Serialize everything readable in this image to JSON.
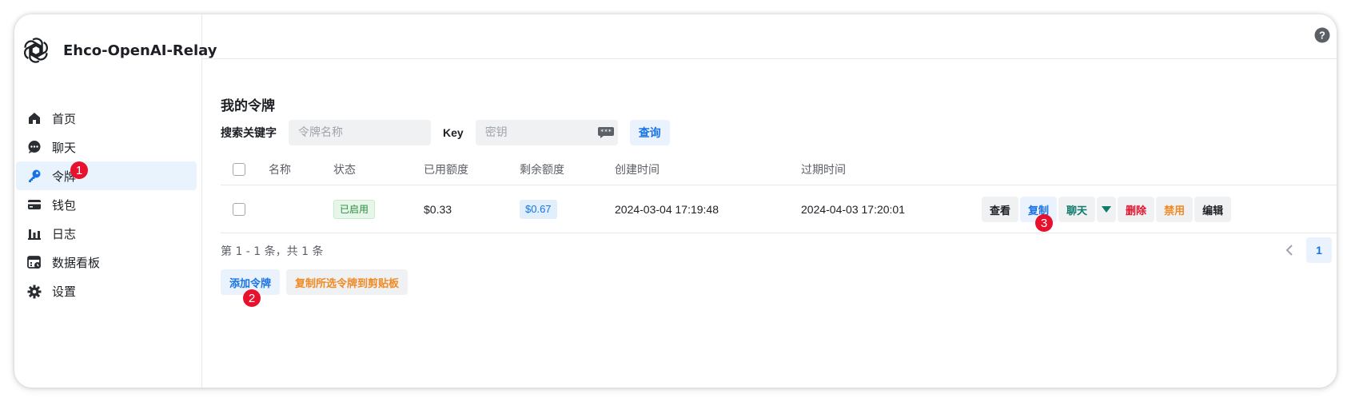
{
  "app": {
    "name": "Ehco-OpenAI-Relay"
  },
  "sidebar": {
    "items": [
      {
        "label": "首页",
        "icon": "home-icon"
      },
      {
        "label": "聊天",
        "icon": "chat-icon"
      },
      {
        "label": "令牌",
        "icon": "key-icon",
        "active": true
      },
      {
        "label": "钱包",
        "icon": "wallet-icon"
      },
      {
        "label": "日志",
        "icon": "chart-bar-icon"
      },
      {
        "label": "数据看板",
        "icon": "dashboard-icon"
      },
      {
        "label": "设置",
        "icon": "gear-icon"
      }
    ]
  },
  "steps": [
    "1",
    "2",
    "3"
  ],
  "page": {
    "title": "我的令牌",
    "search_label": "搜索关键字",
    "name_placeholder": "令牌名称",
    "key_label": "Key",
    "key_placeholder": "密钥",
    "search_button": "查询"
  },
  "table": {
    "headers": [
      "名称",
      "状态",
      "已用额度",
      "剩余额度",
      "创建时间",
      "过期时间"
    ],
    "rows": [
      {
        "name": "",
        "status": "已启用",
        "used": "$0.33",
        "remaining": "$0.67",
        "created": "2024-03-04 17:19:48",
        "expires": "2024-04-03 17:20:01"
      }
    ],
    "actions": {
      "view": "查看",
      "copy": "复制",
      "chat": "聊天",
      "delete": "删除",
      "disable": "禁用",
      "edit": "编辑"
    }
  },
  "pagination": {
    "summary": "第 1 - 1 条，共 1 条",
    "current_page": "1"
  },
  "footer": {
    "add_token": "添加令牌",
    "copy_selected": "复制所选令牌到剪贴板"
  },
  "colors": {
    "accent": "#1773e6",
    "active_bg": "#e9f3fd",
    "danger": "#e8112d",
    "warning": "#f08a24",
    "teal": "#0d7a6b",
    "badge": "#e8112d"
  }
}
